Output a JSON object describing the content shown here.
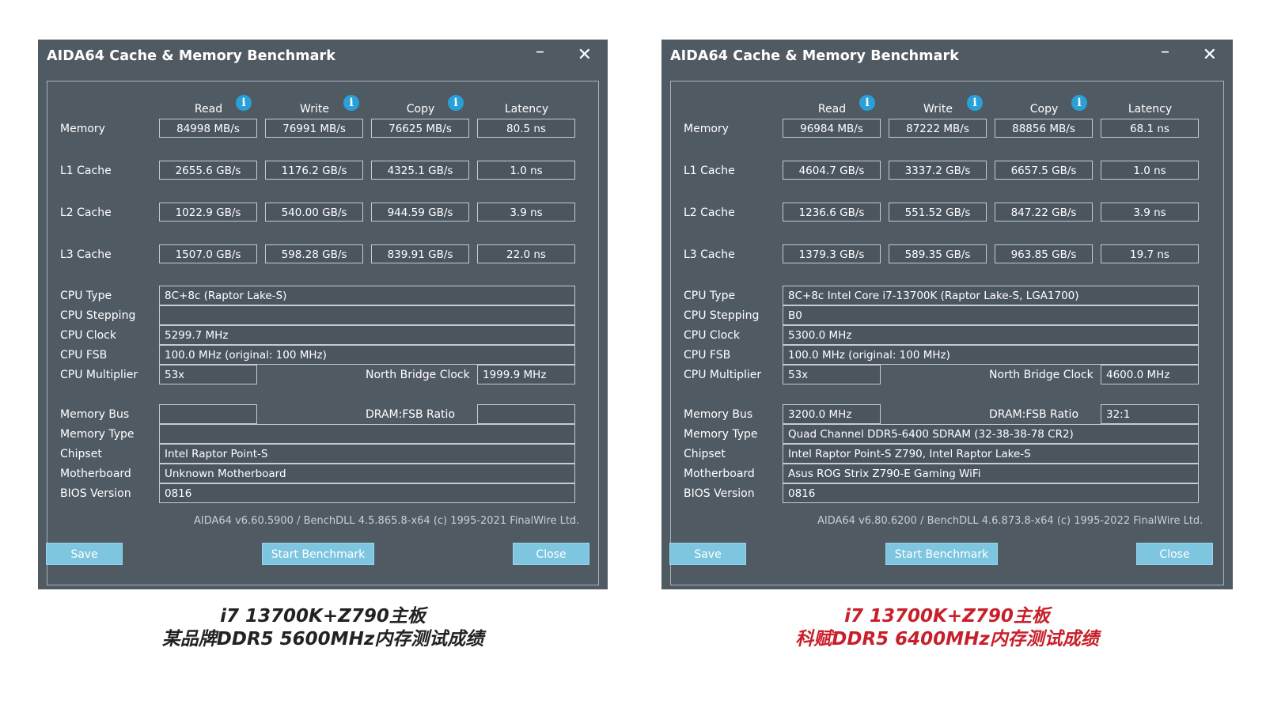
{
  "left": {
    "title": "AIDA64 Cache & Memory Benchmark",
    "minimize": "–",
    "close_x": "✕",
    "headers": {
      "read": "Read",
      "write": "Write",
      "copy": "Copy",
      "latency": "Latency"
    },
    "info_glyph": "i",
    "rows": [
      {
        "label": "Memory",
        "read": "84998 MB/s",
        "write": "76991 MB/s",
        "copy": "76625 MB/s",
        "latency": "80.5 ns"
      },
      {
        "label": "L1 Cache",
        "read": "2655.6 GB/s",
        "write": "1176.2 GB/s",
        "copy": "4325.1 GB/s",
        "latency": "1.0 ns"
      },
      {
        "label": "L2 Cache",
        "read": "1022.9 GB/s",
        "write": "540.00 GB/s",
        "copy": "944.59 GB/s",
        "latency": "3.9 ns"
      },
      {
        "label": "L3 Cache",
        "read": "1507.0 GB/s",
        "write": "598.28 GB/s",
        "copy": "839.91 GB/s",
        "latency": "22.0 ns"
      }
    ],
    "cpu_type_label": "CPU Type",
    "cpu_type": "8C+8c  (Raptor Lake-S)",
    "cpu_stepping_label": "CPU Stepping",
    "cpu_stepping": "",
    "cpu_clock_label": "CPU Clock",
    "cpu_clock": "5299.7 MHz",
    "cpu_fsb_label": "CPU FSB",
    "cpu_fsb": "100.0 MHz  (original: 100 MHz)",
    "cpu_mult_label": "CPU Multiplier",
    "cpu_mult": "53x",
    "nb_clock_label": "North Bridge Clock",
    "nb_clock": "1999.9 MHz",
    "mem_bus_label": "Memory Bus",
    "mem_bus": "",
    "dram_ratio_label": "DRAM:FSB Ratio",
    "dram_ratio": "",
    "mem_type_label": "Memory Type",
    "mem_type": "",
    "chipset_label": "Chipset",
    "chipset": "Intel Raptor Point-S",
    "mobo_label": "Motherboard",
    "mobo": "Unknown Motherboard",
    "bios_label": "BIOS Version",
    "bios": "0816",
    "footer": "AIDA64 v6.60.5900 / BenchDLL 4.5.865.8-x64  (c) 1995-2021 FinalWire Ltd.",
    "save": "Save",
    "start": "Start Benchmark",
    "close": "Close"
  },
  "right": {
    "title": "AIDA64 Cache & Memory Benchmark",
    "minimize": "–",
    "close_x": "✕",
    "headers": {
      "read": "Read",
      "write": "Write",
      "copy": "Copy",
      "latency": "Latency"
    },
    "info_glyph": "i",
    "rows": [
      {
        "label": "Memory",
        "read": "96984 MB/s",
        "write": "87222 MB/s",
        "copy": "88856 MB/s",
        "latency": "68.1 ns"
      },
      {
        "label": "L1 Cache",
        "read": "4604.7 GB/s",
        "write": "3337.2 GB/s",
        "copy": "6657.5 GB/s",
        "latency": "1.0 ns"
      },
      {
        "label": "L2 Cache",
        "read": "1236.6 GB/s",
        "write": "551.52 GB/s",
        "copy": "847.22 GB/s",
        "latency": "3.9 ns"
      },
      {
        "label": "L3 Cache",
        "read": "1379.3 GB/s",
        "write": "589.35 GB/s",
        "copy": "963.85 GB/s",
        "latency": "19.7 ns"
      }
    ],
    "cpu_type_label": "CPU Type",
    "cpu_type": "8C+8c Intel Core i7-13700K  (Raptor Lake-S, LGA1700)",
    "cpu_stepping_label": "CPU Stepping",
    "cpu_stepping": "B0",
    "cpu_clock_label": "CPU Clock",
    "cpu_clock": "5300.0 MHz",
    "cpu_fsb_label": "CPU FSB",
    "cpu_fsb": "100.0 MHz  (original: 100 MHz)",
    "cpu_mult_label": "CPU Multiplier",
    "cpu_mult": "53x",
    "nb_clock_label": "North Bridge Clock",
    "nb_clock": "4600.0 MHz",
    "mem_bus_label": "Memory Bus",
    "mem_bus": "3200.0 MHz",
    "dram_ratio_label": "DRAM:FSB Ratio",
    "dram_ratio": "32:1",
    "mem_type_label": "Memory Type",
    "mem_type": "Quad Channel DDR5-6400 SDRAM  (32-38-38-78 CR2)",
    "chipset_label": "Chipset",
    "chipset": "Intel Raptor Point-S Z790, Intel Raptor Lake-S",
    "mobo_label": "Motherboard",
    "mobo": "Asus ROG Strix Z790-E Gaming WiFi",
    "bios_label": "BIOS Version",
    "bios": "0816",
    "footer": "AIDA64 v6.80.6200 / BenchDLL 4.6.873.8-x64  (c) 1995-2022 FinalWire Ltd.",
    "save": "Save",
    "start": "Start Benchmark",
    "close": "Close"
  },
  "captions": {
    "left_line1": "i7 13700K+Z790主板",
    "left_line2": "某品牌DDR5  5600MHz内存测试成绩",
    "right_line1": "i7 13700K+Z790主板",
    "right_line2": "科赋DDR5  6400MHz内存测试成绩",
    "left_color": "#222222",
    "right_color": "#c8202a"
  },
  "colors": {
    "window_bg": "#505a63",
    "button_bg": "#7ec6e0",
    "info_bg": "#2aa0d8"
  }
}
